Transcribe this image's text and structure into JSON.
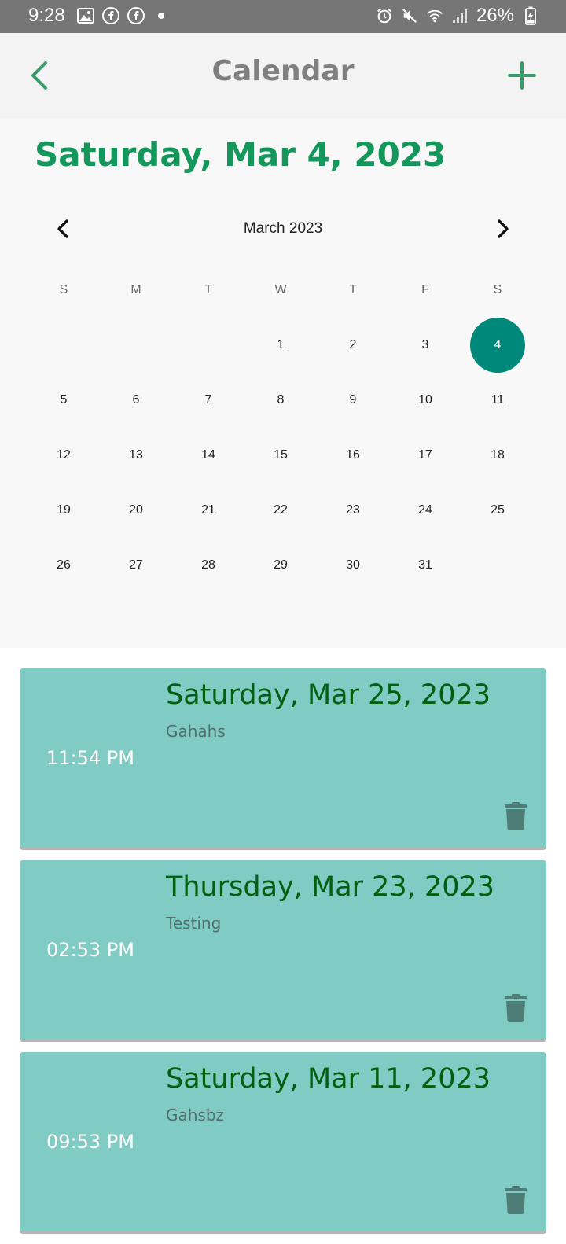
{
  "status_bar": {
    "time": "9:28",
    "battery": "26%",
    "left_icons": [
      "image-icon",
      "facebook-icon",
      "facebook-icon",
      "dot-icon"
    ],
    "right_icons": [
      "alarm-icon",
      "mute-icon",
      "wifi-icon",
      "signal-icon",
      "battery-charging-icon"
    ]
  },
  "app_bar": {
    "title": "Calendar",
    "back_icon": "chevron-left-icon",
    "add_icon": "plus-icon",
    "accent_color": "#3a9a6c"
  },
  "calendar": {
    "selected_date_heading": "Saturday, Mar 4, 2023",
    "month_label": "March 2023",
    "weekdays": [
      "S",
      "M",
      "T",
      "W",
      "T",
      "F",
      "S"
    ],
    "days": [
      "",
      "",
      "",
      "1",
      "2",
      "3",
      "4",
      "5",
      "6",
      "7",
      "8",
      "9",
      "10",
      "11",
      "12",
      "13",
      "14",
      "15",
      "16",
      "17",
      "18",
      "19",
      "20",
      "21",
      "22",
      "23",
      "24",
      "25",
      "26",
      "27",
      "28",
      "29",
      "30",
      "31",
      ""
    ],
    "selected_day": "4",
    "selected_color": "#00897b",
    "heading_color": "#13975a"
  },
  "events": [
    {
      "date": "Saturday, Mar 25, 2023",
      "title": "Gahahs",
      "time": "11:54 PM"
    },
    {
      "date": "Thursday, Mar 23, 2023",
      "title": "Testing",
      "time": "02:53 PM"
    },
    {
      "date": "Saturday, Mar 11, 2023",
      "title": "Gahsbz",
      "time": "09:53 PM"
    }
  ],
  "event_card_color": "#80cbc4"
}
